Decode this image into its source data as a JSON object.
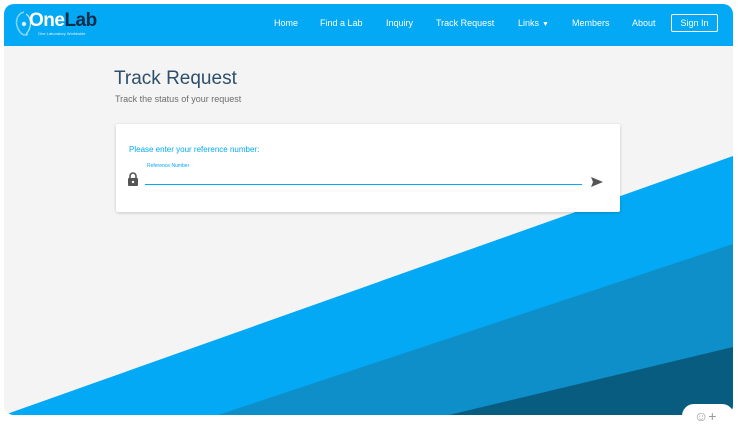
{
  "brand": {
    "name_part1": "One",
    "name_part2": "Lab",
    "tagline": "One Laboratory Worldwide"
  },
  "nav": {
    "items": [
      {
        "label": "Home"
      },
      {
        "label": "Find a Lab"
      },
      {
        "label": "Inquiry"
      },
      {
        "label": "Track Request"
      },
      {
        "label": "Links"
      },
      {
        "label": "Members"
      },
      {
        "label": "About"
      }
    ],
    "links_caret": "▼",
    "signin_label": "Sign In"
  },
  "page": {
    "title": "Track Request",
    "subtitle": "Track the status of your request"
  },
  "form": {
    "prompt": "Please enter your reference number:",
    "field_label": "Reference Number",
    "field_value": "",
    "field_placeholder": ""
  },
  "corner": {
    "glyph": "☺+"
  },
  "colors": {
    "primary": "#03a9f4",
    "stripe_mid": "#0e8fc9",
    "stripe_dark": "#075c80",
    "background": "#f4f4f4",
    "title": "#2d4f6c"
  },
  "icons": {
    "lock": "lock-icon",
    "send": "send-icon",
    "logo_mark": "logo-mark-icon"
  }
}
